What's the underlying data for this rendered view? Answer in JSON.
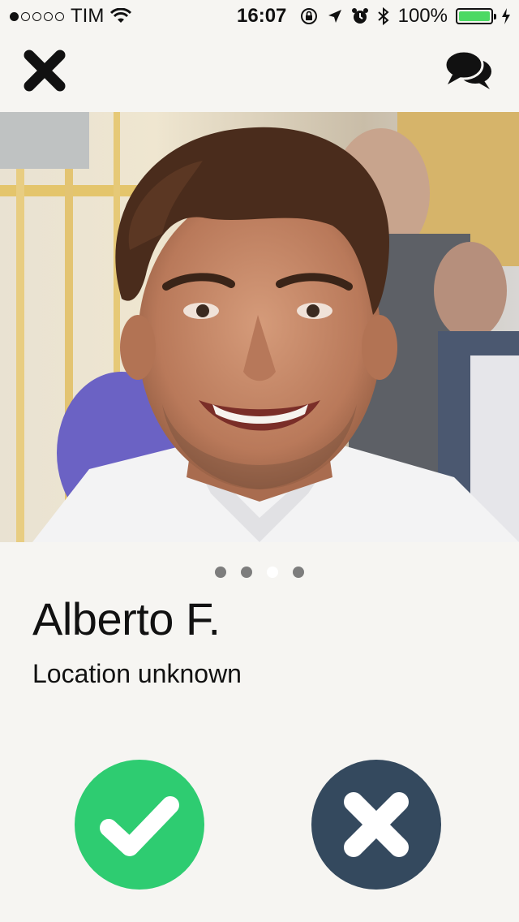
{
  "status_bar": {
    "carrier": "TIM",
    "time": "16:07",
    "battery_percent": "100%",
    "signal_strength_of_5": 1,
    "battery_color": "#4cd964"
  },
  "nav": {
    "close_icon": "close-icon",
    "chat_icon": "chat-bubbles-icon"
  },
  "profile": {
    "name": "Alberto F.",
    "location": "Location unknown",
    "photo_count": 4,
    "active_photo_index": 2
  },
  "actions": {
    "accept_icon": "checkmark-icon",
    "reject_icon": "close-icon",
    "accept_color": "#2ecc71",
    "reject_color": "#34495e"
  }
}
